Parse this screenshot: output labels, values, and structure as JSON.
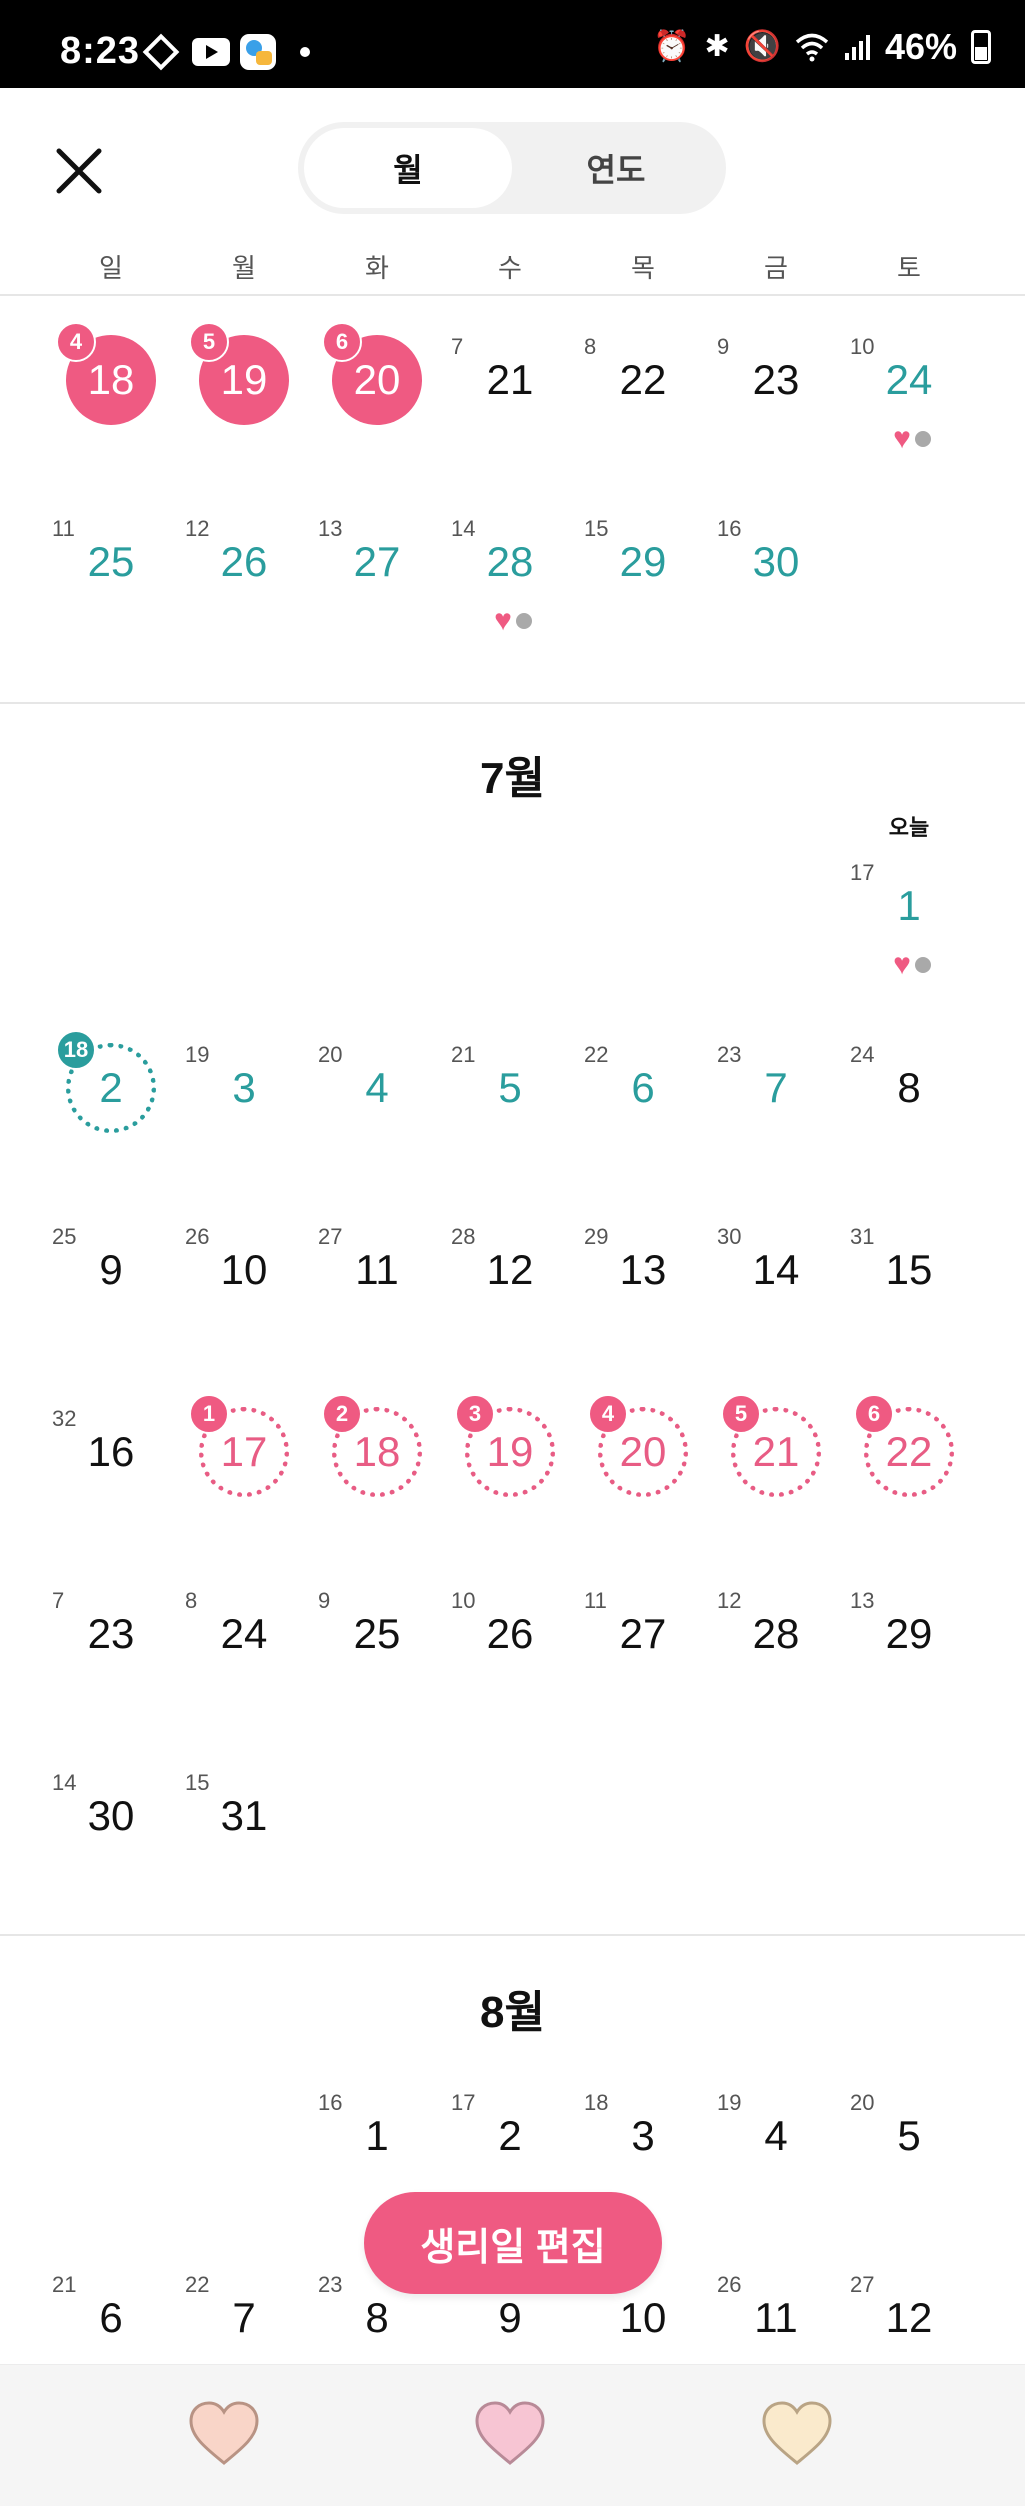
{
  "status_bar": {
    "time": "8:23",
    "battery": "46%",
    "icons": [
      "diamond-icon",
      "youtube-icon",
      "app-icon",
      "dot-icon",
      "alarm-icon",
      "bluetooth-icon",
      "mute-icon",
      "wifi-icon",
      "signal-icon",
      "battery-icon"
    ]
  },
  "header": {
    "close_icon": "close-icon",
    "tabs": [
      {
        "label": "월",
        "active": true
      },
      {
        "label": "연도",
        "active": false
      }
    ]
  },
  "weekdays": [
    "일",
    "월",
    "화",
    "수",
    "목",
    "금",
    "토"
  ],
  "june": {
    "rows": [
      [
        {
          "cycle": "4",
          "day": "18",
          "style": "period-solid"
        },
        {
          "cycle": "5",
          "day": "19",
          "style": "period-solid"
        },
        {
          "cycle": "6",
          "day": "20",
          "style": "period-solid"
        },
        {
          "cycle": "7",
          "day": "21",
          "style": "normal"
        },
        {
          "cycle": "8",
          "day": "22",
          "style": "normal"
        },
        {
          "cycle": "9",
          "day": "23",
          "style": "normal"
        },
        {
          "cycle": "10",
          "day": "24",
          "style": "teal",
          "marks": true
        }
      ],
      [
        {
          "cycle": "11",
          "day": "25",
          "style": "teal"
        },
        {
          "cycle": "12",
          "day": "26",
          "style": "teal"
        },
        {
          "cycle": "13",
          "day": "27",
          "style": "teal"
        },
        {
          "cycle": "14",
          "day": "28",
          "style": "teal",
          "marks": true
        },
        {
          "cycle": "15",
          "day": "29",
          "style": "teal"
        },
        {
          "cycle": "16",
          "day": "30",
          "style": "teal"
        },
        null
      ]
    ]
  },
  "july": {
    "title": "7월",
    "today_label": "오늘",
    "rows": [
      [
        null,
        null,
        null,
        null,
        null,
        null,
        {
          "cycle": "17",
          "day": "1",
          "style": "teal",
          "marks": true
        }
      ],
      [
        {
          "cycle": "18",
          "day": "2",
          "style": "teal-dotted"
        },
        {
          "cycle": "19",
          "day": "3",
          "style": "teal"
        },
        {
          "cycle": "20",
          "day": "4",
          "style": "teal"
        },
        {
          "cycle": "21",
          "day": "5",
          "style": "teal"
        },
        {
          "cycle": "22",
          "day": "6",
          "style": "teal"
        },
        {
          "cycle": "23",
          "day": "7",
          "style": "teal"
        },
        {
          "cycle": "24",
          "day": "8",
          "style": "normal"
        }
      ],
      [
        {
          "cycle": "25",
          "day": "9",
          "style": "normal"
        },
        {
          "cycle": "26",
          "day": "10",
          "style": "normal"
        },
        {
          "cycle": "27",
          "day": "11",
          "style": "normal"
        },
        {
          "cycle": "28",
          "day": "12",
          "style": "normal"
        },
        {
          "cycle": "29",
          "day": "13",
          "style": "normal"
        },
        {
          "cycle": "30",
          "day": "14",
          "style": "normal"
        },
        {
          "cycle": "31",
          "day": "15",
          "style": "normal"
        }
      ],
      [
        {
          "cycle": "32",
          "day": "16",
          "style": "normal"
        },
        {
          "cycle": "1",
          "day": "17",
          "style": "period-dotted"
        },
        {
          "cycle": "2",
          "day": "18",
          "style": "period-dotted"
        },
        {
          "cycle": "3",
          "day": "19",
          "style": "period-dotted"
        },
        {
          "cycle": "4",
          "day": "20",
          "style": "period-dotted"
        },
        {
          "cycle": "5",
          "day": "21",
          "style": "period-dotted"
        },
        {
          "cycle": "6",
          "day": "22",
          "style": "period-dotted"
        }
      ],
      [
        {
          "cycle": "7",
          "day": "23",
          "style": "normal"
        },
        {
          "cycle": "8",
          "day": "24",
          "style": "normal"
        },
        {
          "cycle": "9",
          "day": "25",
          "style": "normal"
        },
        {
          "cycle": "10",
          "day": "26",
          "style": "normal"
        },
        {
          "cycle": "11",
          "day": "27",
          "style": "normal"
        },
        {
          "cycle": "12",
          "day": "28",
          "style": "normal"
        },
        {
          "cycle": "13",
          "day": "29",
          "style": "normal"
        }
      ],
      [
        {
          "cycle": "14",
          "day": "30",
          "style": "normal"
        },
        {
          "cycle": "15",
          "day": "31",
          "style": "normal"
        },
        null,
        null,
        null,
        null,
        null
      ]
    ]
  },
  "august": {
    "title": "8월",
    "rows": [
      [
        null,
        null,
        {
          "cycle": "16",
          "day": "1",
          "style": "normal"
        },
        {
          "cycle": "17",
          "day": "2",
          "style": "normal"
        },
        {
          "cycle": "18",
          "day": "3",
          "style": "normal"
        },
        {
          "cycle": "19",
          "day": "4",
          "style": "normal"
        },
        {
          "cycle": "20",
          "day": "5",
          "style": "normal"
        }
      ],
      [
        {
          "cycle": "21",
          "day": "6",
          "style": "normal"
        },
        {
          "cycle": "22",
          "day": "7",
          "style": "normal"
        },
        {
          "cycle": "23",
          "day": "8",
          "style": "normal"
        },
        {
          "cycle": "",
          "day": "9",
          "style": "normal"
        },
        {
          "cycle": "",
          "day": "10",
          "style": "normal"
        },
        {
          "cycle": "26",
          "day": "11",
          "style": "normal"
        },
        {
          "cycle": "27",
          "day": "12",
          "style": "normal"
        }
      ]
    ]
  },
  "edit_button": {
    "label": "생리일 편집"
  },
  "bottom_nav": [
    {
      "icon": "heart-icon",
      "color": "#f9d5c8"
    },
    {
      "icon": "heart-icon",
      "color": "#f7c5d3"
    },
    {
      "icon": "heart-icon",
      "color": "#faeacc"
    }
  ],
  "colors": {
    "period": "#ef5a82",
    "fertile": "#2a9d9d",
    "mark_dot": "#a9a9a9"
  }
}
